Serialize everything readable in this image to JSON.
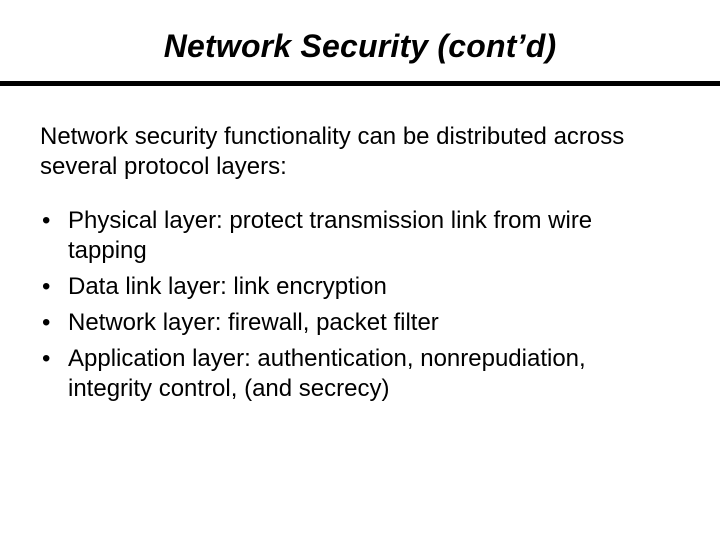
{
  "title": "Network Security (cont’d)",
  "intro": "Network security functionality can be distributed across several protocol layers:",
  "bullets": [
    "Physical layer: protect transmission link from wire tapping",
    "Data link layer: link encryption",
    "Network layer: firewall, packet filter",
    "Application layer: authentication, nonrepudiation, integrity control, (and secrecy)"
  ]
}
